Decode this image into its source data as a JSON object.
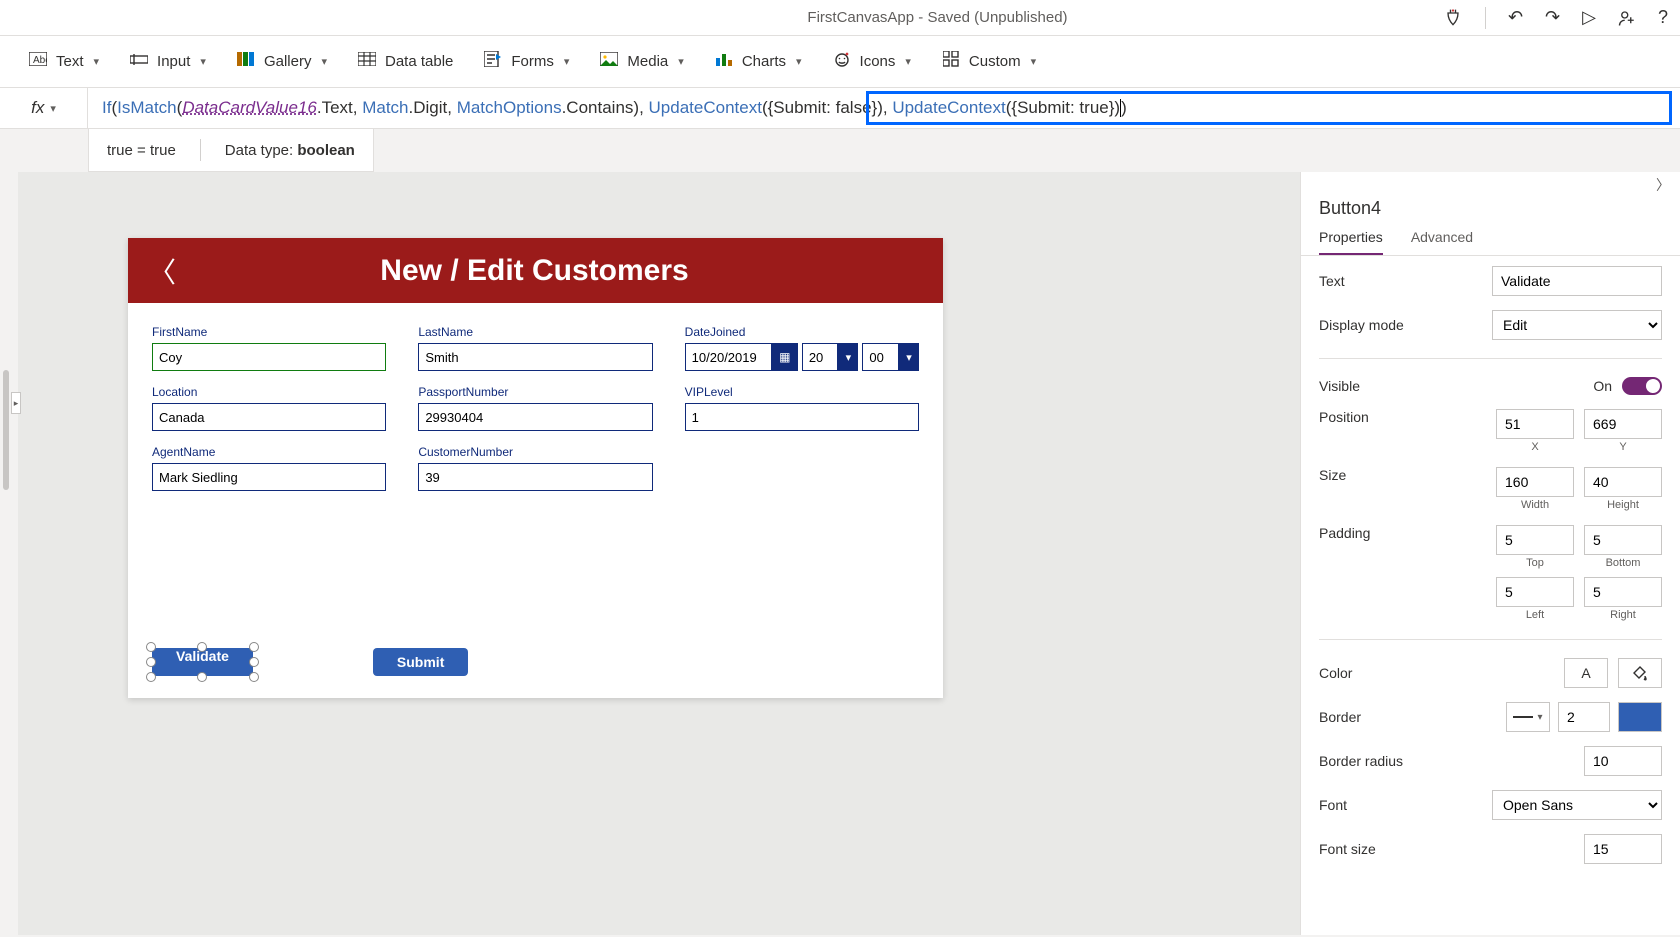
{
  "titlebar": {
    "title": "FirstCanvasApp - Saved (Unpublished)"
  },
  "ribbon": {
    "text": "Text",
    "input": "Input",
    "gallery": "Gallery",
    "datatable": "Data table",
    "forms": "Forms",
    "media": "Media",
    "charts": "Charts",
    "icons": "Icons",
    "custom": "Custom"
  },
  "formula": {
    "fx": "fx",
    "tokens": {
      "if": "If",
      "ismatch": "IsMatch",
      "datacardvalue": "DataCardValue16",
      "text": ".Text",
      "comma1": ", ",
      "match": "Match",
      "digit": ".Digit",
      "comma2": ", ",
      "matchoptions": "MatchOptions",
      "contains": ".Contains",
      "close1": "),",
      "uc1": "UpdateContext",
      "submit_false": "({Submit: false}), ",
      "uc2": "UpdateContext",
      "submit_true": "({Submit: true})",
      "close2": ")"
    }
  },
  "intellisense": {
    "eval": "true  =  true",
    "datatype_label": "Data type:",
    "datatype_value": "boolean"
  },
  "canvas": {
    "header": "New / Edit Customers",
    "fields": {
      "firstname": {
        "label": "FirstName",
        "value": "Coy"
      },
      "lastname": {
        "label": "LastName",
        "value": "Smith"
      },
      "datejoined": {
        "label": "DateJoined",
        "date": "10/20/2019",
        "hour": "20",
        "minute": "00"
      },
      "location": {
        "label": "Location",
        "value": "Canada"
      },
      "passport": {
        "label": "PassportNumber",
        "value": "29930404"
      },
      "viplevel": {
        "label": "VIPLevel",
        "value": "1"
      },
      "agentname": {
        "label": "AgentName",
        "value": "Mark Siedling"
      },
      "customernumber": {
        "label": "CustomerNumber",
        "value": "39"
      }
    },
    "buttons": {
      "validate": "Validate",
      "submit": "Submit"
    }
  },
  "props": {
    "name": "Button4",
    "tabs": {
      "properties": "Properties",
      "advanced": "Advanced"
    },
    "text_label": "Text",
    "text_value": "Validate",
    "displaymode_label": "Display mode",
    "displaymode_value": "Edit",
    "visible_label": "Visible",
    "visible_value": "On",
    "position_label": "Position",
    "position_x": "51",
    "position_y": "669",
    "x_label": "X",
    "y_label": "Y",
    "size_label": "Size",
    "size_w": "160",
    "size_h": "40",
    "w_label": "Width",
    "h_label": "Height",
    "padding_label": "Padding",
    "pad_top": "5",
    "pad_bottom": "5",
    "pad_left": "5",
    "pad_right": "5",
    "top_label": "Top",
    "bottom_label": "Bottom",
    "left_label": "Left",
    "right_label": "Right",
    "color_label": "Color",
    "border_label": "Border",
    "border_width": "2",
    "borderradius_label": "Border radius",
    "borderradius_value": "10",
    "font_label": "Font",
    "font_value": "Open Sans",
    "fontsize_label": "Font size",
    "fontsize_value": "15"
  }
}
